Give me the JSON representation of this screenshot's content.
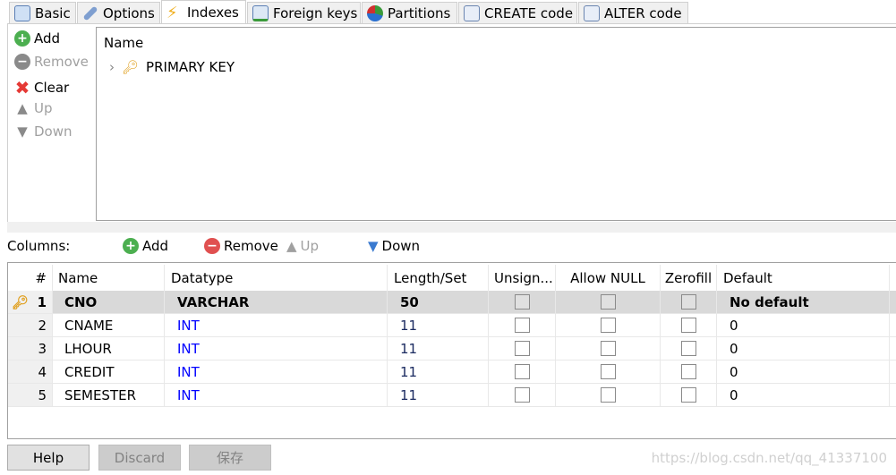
{
  "tabs": [
    {
      "label": "Basic",
      "icon": "table-icon",
      "active": false
    },
    {
      "label": "Options",
      "icon": "wrench-icon",
      "active": false
    },
    {
      "label": "Indexes",
      "icon": "lightning-icon",
      "active": true
    },
    {
      "label": "Foreign keys",
      "icon": "foreign-key-icon",
      "active": false
    },
    {
      "label": "Partitions",
      "icon": "pie-icon",
      "active": false
    },
    {
      "label": "CREATE code",
      "icon": "document-icon",
      "active": false
    },
    {
      "label": "ALTER code",
      "icon": "document-icon",
      "active": false
    }
  ],
  "index_toolbar": {
    "add": "Add",
    "remove": "Remove",
    "clear": "Clear",
    "up": "Up",
    "down": "Down"
  },
  "index_tree": {
    "header": "Name",
    "items": [
      {
        "label": "PRIMARY KEY"
      }
    ]
  },
  "columns_toolbar": {
    "label": "Columns:",
    "add": "Add",
    "remove": "Remove",
    "up": "Up",
    "down": "Down"
  },
  "grid": {
    "headers": {
      "num": "#",
      "name": "Name",
      "datatype": "Datatype",
      "length": "Length/Set",
      "unsigned": "Unsign...",
      "allow_null": "Allow NULL",
      "zerofill": "Zerofill",
      "default": "Default"
    },
    "rows": [
      {
        "num": "1",
        "name": "CNO",
        "datatype": "VARCHAR",
        "length": "50",
        "unsigned": false,
        "allow_null": false,
        "zerofill": false,
        "default": "No default",
        "primary": true
      },
      {
        "num": "2",
        "name": "CNAME",
        "datatype": "INT",
        "length": "11",
        "unsigned": false,
        "allow_null": false,
        "zerofill": false,
        "default": "0"
      },
      {
        "num": "3",
        "name": "LHOUR",
        "datatype": "INT",
        "length": "11",
        "unsigned": false,
        "allow_null": false,
        "zerofill": false,
        "default": "0"
      },
      {
        "num": "4",
        "name": "CREDIT",
        "datatype": "INT",
        "length": "11",
        "unsigned": false,
        "allow_null": false,
        "zerofill": false,
        "default": "0"
      },
      {
        "num": "5",
        "name": "SEMESTER",
        "datatype": "INT",
        "length": "11",
        "unsigned": false,
        "allow_null": false,
        "zerofill": false,
        "default": "0"
      }
    ]
  },
  "footer": {
    "help": "Help",
    "discard": "Discard",
    "save": "保存",
    "watermark": "https://blog.csdn.net/qq_41337100"
  },
  "colors": {
    "datatype_int": "#0000ff",
    "selected_row": "#d9d9d9"
  }
}
